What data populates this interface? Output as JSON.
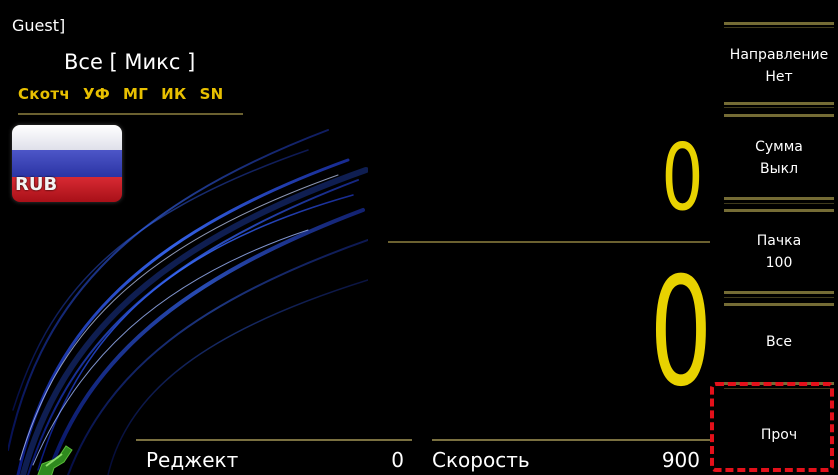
{
  "header": {
    "user": "Guest]",
    "mode_label": "Все [ Микс ]"
  },
  "features": [
    "Скотч",
    "УФ",
    "МГ",
    "ИК",
    "SN"
  ],
  "currency": {
    "code": "RUB",
    "flag_icon": "russia-flag-icon"
  },
  "counters": {
    "top_value": "0",
    "bottom_value": "0"
  },
  "status": {
    "reject_label": "Реджект",
    "reject_value": "0",
    "speed_label": "Скорость",
    "speed_value": "900"
  },
  "side_menu": [
    {
      "line1": "Направление",
      "line2": "Нет"
    },
    {
      "line1": "Сумма",
      "line2": "Выкл"
    },
    {
      "line1": "Пачка",
      "line2": "100"
    },
    {
      "line1": "Все",
      "line2": ""
    },
    {
      "line1": "Проч",
      "line2": ""
    }
  ],
  "colors": {
    "accent_yellow": "#e8d200",
    "feature_yellow": "#e8c000",
    "highlight_red": "#e3101a",
    "background": "#000000"
  }
}
